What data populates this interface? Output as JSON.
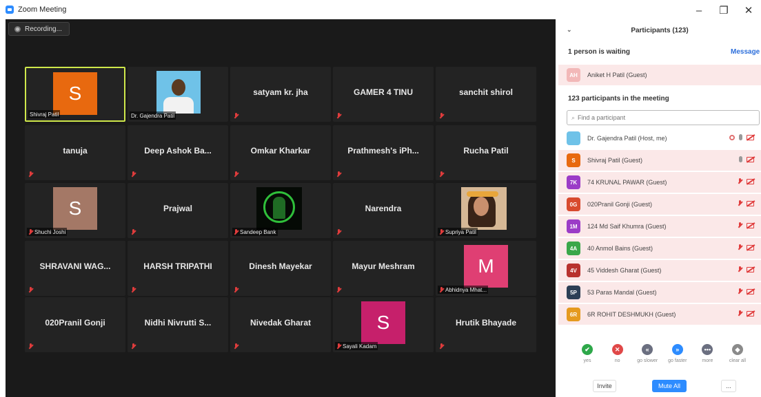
{
  "window": {
    "title": "Zoom Meeting",
    "controls": [
      "–",
      "❐",
      "✕"
    ]
  },
  "recording": {
    "label": "Recording..."
  },
  "gallery": {
    "tiles": [
      {
        "type": "letter",
        "letter": "S",
        "color": "#e8690f",
        "label": "Shivraj Patil",
        "active": true
      },
      {
        "type": "photo",
        "label": "Dr. Gajendra Patil"
      },
      {
        "type": "name",
        "name": "satyam kr. jha",
        "muted": true
      },
      {
        "type": "name",
        "name": "GAMER 4 TINU",
        "muted": true
      },
      {
        "type": "name",
        "name": "sanchit shirol",
        "muted": true
      },
      {
        "type": "name",
        "name": "tanuja",
        "muted": true
      },
      {
        "type": "name",
        "name": "Deep Ashok Ba...",
        "muted": true
      },
      {
        "type": "name",
        "name": "Omkar Kharkar",
        "muted": true
      },
      {
        "type": "name",
        "name": "Prathmesh's iPh...",
        "muted": true
      },
      {
        "type": "name",
        "name": "Rucha Patil",
        "muted": true
      },
      {
        "type": "letter",
        "letter": "S",
        "color": "#a47866",
        "label": "Shuchi Joshi",
        "muted": true
      },
      {
        "type": "name",
        "name": "Prajwal",
        "muted": true
      },
      {
        "type": "photo-green",
        "label": "Sandeep Bank",
        "muted": true
      },
      {
        "type": "name",
        "name": "Narendra",
        "muted": true
      },
      {
        "type": "photo-girl",
        "label": "Supriya Patil",
        "muted": true
      },
      {
        "type": "name",
        "name": "SHRAVANI WAG...",
        "muted": true
      },
      {
        "type": "name",
        "name": "HARSH TRIPATHI",
        "muted": true
      },
      {
        "type": "name",
        "name": "Dinesh Mayekar",
        "muted": true
      },
      {
        "type": "name",
        "name": "Mayur Meshram",
        "muted": true
      },
      {
        "type": "letter",
        "letter": "M",
        "color": "#df3f73",
        "label": "Abhidnya Mhat...",
        "muted": true
      },
      {
        "type": "name",
        "name": "020Pranil Gonji",
        "muted": true
      },
      {
        "type": "name",
        "name": "Nidhi Nivrutti S...",
        "muted": true
      },
      {
        "type": "name",
        "name": "Nivedak Gharat",
        "muted": true
      },
      {
        "type": "letter",
        "letter": "S",
        "color": "#c6206b",
        "label": "Sayali Kadam",
        "muted": true
      },
      {
        "type": "name",
        "name": "Hrutik Bhayade",
        "muted": true
      }
    ]
  },
  "participants": {
    "header": "Participants (123)",
    "collapse_icon": "chevron-down-icon",
    "waiting_heading": "1 person is waiting",
    "message_link": "Message",
    "waiting_person": {
      "initials": "AH",
      "name": "Aniket H Patil (Guest)"
    },
    "in_meeting_heading": "123 participants in the meeting",
    "search_placeholder": "Find a participant",
    "list": [
      {
        "initials": "",
        "photo": true,
        "name": "Dr. Gajendra Patil (Host, me)",
        "color": "#6fc2e8"
      },
      {
        "initials": "S",
        "name": "Shivraj Patil (Guest)",
        "color": "#e8690f"
      },
      {
        "initials": "7K",
        "name": "74 KRUNAL PAWAR (Guest)",
        "color": "#9b3cc7"
      },
      {
        "initials": "0G",
        "name": "020Pranil Gonji (Guest)",
        "color": "#d84a2e"
      },
      {
        "initials": "1M",
        "name": "124 Md Saif Khumra (Guest)",
        "color": "#9b3cc7"
      },
      {
        "initials": "4A",
        "name": "40 Anmol Bains (Guest)",
        "color": "#3aa74a"
      },
      {
        "initials": "4V",
        "name": "45 Viddesh Gharat (Guest)",
        "color": "#b8322e"
      },
      {
        "initials": "5P",
        "name": "53 Paras Mandal (Guest)",
        "color": "#2c3f55"
      },
      {
        "initials": "6R",
        "name": "6R ROHIT DESHMUKH (Guest)",
        "color": "#e59a1f"
      }
    ],
    "reactions": [
      {
        "symbol": "✔",
        "label": "yes",
        "color": "#2ea84a"
      },
      {
        "symbol": "✕",
        "label": "no",
        "color": "#e04848"
      },
      {
        "symbol": "«",
        "label": "go slower",
        "color": "#6b6f80"
      },
      {
        "symbol": "»",
        "label": "go faster",
        "color": "#2d8cff"
      },
      {
        "symbol": "•••",
        "label": "more",
        "color": "#6b6f80"
      },
      {
        "symbol": "◆",
        "label": "clear all",
        "color": "#8a8a8a"
      }
    ],
    "buttons": {
      "invite": "Invite",
      "mute_all": "Mute All",
      "more": "..."
    }
  }
}
